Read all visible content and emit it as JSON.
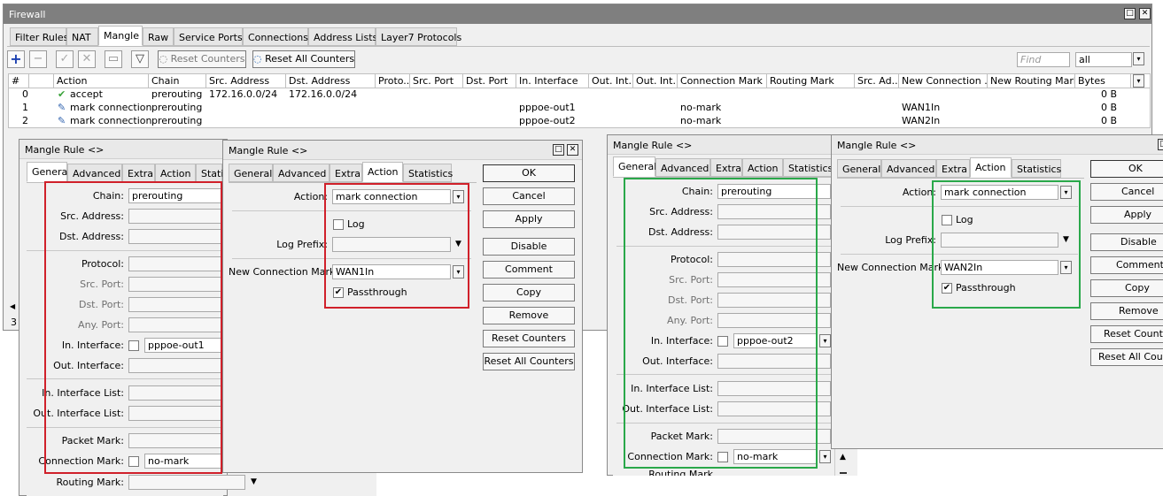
{
  "firewall": {
    "title": "Firewall",
    "tabs": [
      "Filter Rules",
      "NAT",
      "Mangle",
      "Raw",
      "Service Ports",
      "Connections",
      "Address Lists",
      "Layer7 Protocols"
    ],
    "toolbar": {
      "reset_counters": "Reset Counters",
      "reset_all_counters": "Reset All Counters",
      "find_placeholder": "Find",
      "filter_value": "all"
    },
    "columns": [
      "#",
      "Action",
      "Chain",
      "Src. Address",
      "Dst. Address",
      "Proto...",
      "Src. Port",
      "Dst. Port",
      "In. Interface",
      "Out. Int...",
      "Out. Int...",
      "Connection Mark",
      "Routing Mark",
      "Src. Ad...",
      "New Connection ...",
      "New Routing Mark",
      "Bytes"
    ],
    "rows": [
      {
        "num": "0",
        "action": "accept",
        "chain": "prerouting",
        "src": "172.16.0.0/24",
        "dst": "172.16.0.0/24",
        "in_iface": "",
        "conn_mark": "",
        "new_conn": "",
        "bytes": "0 B"
      },
      {
        "num": "1",
        "action": "mark connection",
        "chain": "prerouting",
        "src": "",
        "dst": "",
        "in_iface": "pppoe-out1",
        "conn_mark": "no-mark",
        "new_conn": "WAN1In",
        "bytes": "0 B"
      },
      {
        "num": "2",
        "action": "mark connection",
        "chain": "prerouting",
        "src": "",
        "dst": "",
        "in_iface": "pppoe-out2",
        "conn_mark": "no-mark",
        "new_conn": "WAN2In",
        "bytes": "0 B"
      }
    ],
    "status_count": "3"
  },
  "general_tabs_a": [
    "General",
    "Advanced",
    "Extra",
    "Action",
    "Statis"
  ],
  "general_tabs_c": [
    "General",
    "Advanced",
    "Extra",
    "Action",
    "Statistics"
  ],
  "action_tabs": [
    "General",
    "Advanced",
    "Extra",
    "Action",
    "Statistics"
  ],
  "general_labels": {
    "chain": "Chain:",
    "src_address": "Src. Address:",
    "dst_address": "Dst. Address:",
    "protocol": "Protocol:",
    "src_port": "Src. Port:",
    "dst_port": "Dst. Port:",
    "any_port": "Any. Port:",
    "in_interface": "In. Interface:",
    "out_interface": "Out. Interface:",
    "in_interface_list": "In. Interface List:",
    "out_interface_list": "Out. Interface List:",
    "packet_mark": "Packet Mark:",
    "connection_mark": "Connection Mark:",
    "routing_mark": "Routing Mark:"
  },
  "action_labels": {
    "action": "Action:",
    "log": "Log",
    "log_prefix": "Log Prefix:",
    "new_connection_mark": "New Connection Mark:",
    "passthrough": "Passthrough"
  },
  "buttons": [
    "OK",
    "Cancel",
    "Apply",
    "Disable",
    "Comment",
    "Copy",
    "Remove",
    "Reset Counters",
    "Reset All Counters"
  ],
  "buttons_cut": [
    "OK",
    "Cancel",
    "Apply",
    "Disable",
    "Comment",
    "Copy",
    "Remove",
    "Reset Counter",
    "Reset All Count"
  ],
  "dialog_a": {
    "title": "Mangle Rule <>",
    "chain": "prerouting",
    "in_interface": "pppoe-out1",
    "connection_mark": "no-mark"
  },
  "dialog_b": {
    "title": "Mangle Rule <>",
    "action": "mark connection",
    "new_connection_mark": "WAN1In"
  },
  "dialog_c": {
    "title": "Mangle Rule <>",
    "chain": "prerouting",
    "in_interface": "pppoe-out2",
    "connection_mark": "no-mark",
    "routing_mark_partial": "Routing Mark"
  },
  "dialog_d": {
    "title": "Mangle Rule <>",
    "action": "mark connection",
    "new_connection_mark": "WAN2In"
  },
  "colors": {
    "red_highlight": "#d0202a",
    "green_highlight": "#2aa84a",
    "accept_icon": "#3aa33a",
    "add_icon": "#1a3fb0"
  }
}
